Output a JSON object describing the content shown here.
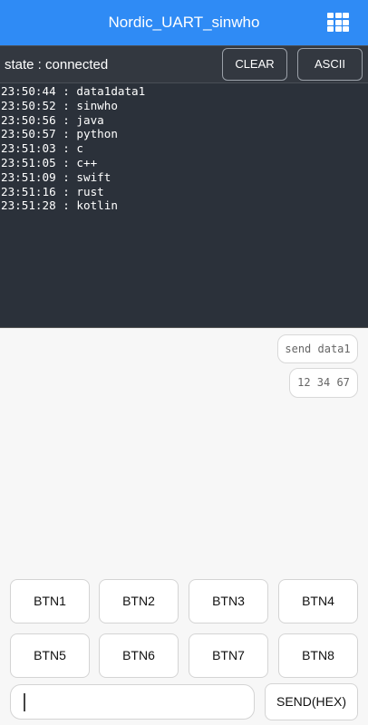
{
  "appbar": {
    "title": "Nordic_UART_sinwho",
    "menu_icon": "grid-icon"
  },
  "statebar": {
    "state": "state : connected",
    "clear_label": "CLEAR",
    "ascii_label": "ASCII"
  },
  "log": {
    "lines": [
      "23:50:44 : data1data1",
      "23:50:52 : sinwho",
      "23:50:56 : java",
      "23:50:57 : python",
      "23:51:03 : c",
      "23:51:05 : c++",
      "23:51:09 : swift",
      "23:51:16 : rust",
      "23:51:28 : kotlin"
    ]
  },
  "quick_messages": [
    "send data1",
    "12 34 67"
  ],
  "buttons": [
    "BTN1",
    "BTN2",
    "BTN3",
    "BTN4",
    "BTN5",
    "BTN6",
    "BTN7",
    "BTN8"
  ],
  "input": {
    "value": "",
    "placeholder": ""
  },
  "send_label": "SEND(HEX)",
  "colors": {
    "appbar": "#2f8bf5",
    "log_bg": "#2b313a",
    "statebar_bg": "#333840"
  }
}
